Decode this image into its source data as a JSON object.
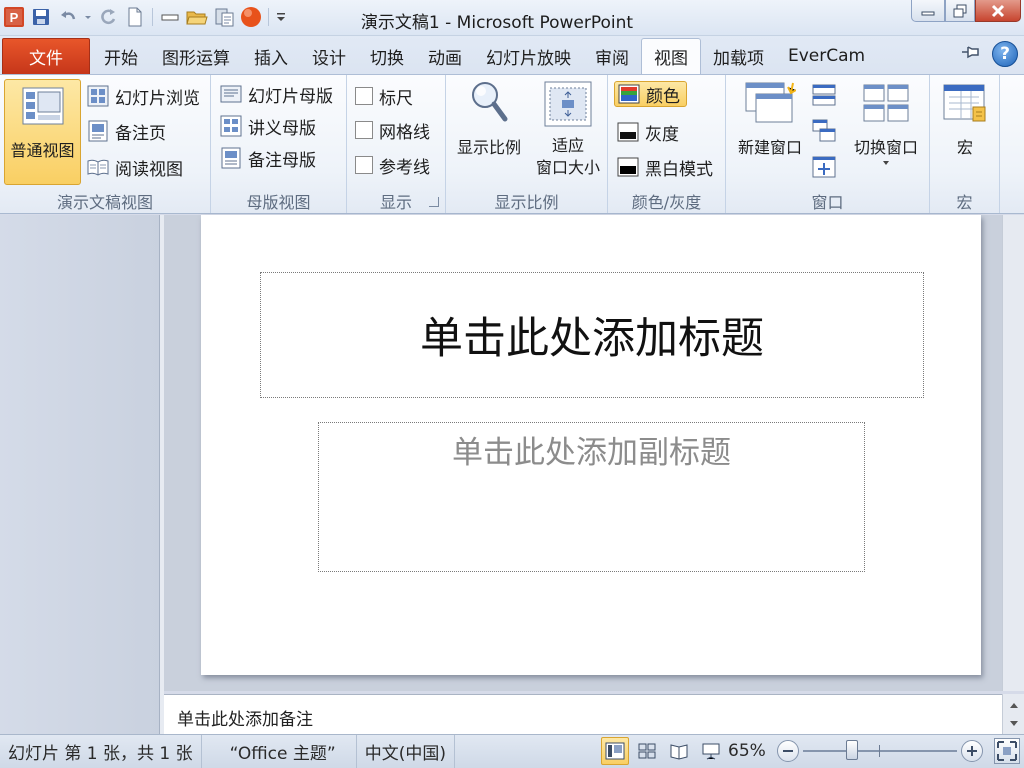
{
  "window": {
    "title": "演示文稿1 - Microsoft PowerPoint"
  },
  "quick_access": {
    "icons": [
      "powerpoint-logo-icon",
      "save-icon",
      "undo-icon",
      "redo-icon",
      "new-document-icon",
      "minus-icon",
      "open-folder-icon",
      "clipboard-icon",
      "record-icon",
      "customize-dropdown-icon"
    ]
  },
  "tabs": {
    "file": "文件",
    "items": [
      "开始",
      "图形运算",
      "插入",
      "设计",
      "切换",
      "动画",
      "幻灯片放映",
      "审阅",
      "视图",
      "加载项",
      "EverCam"
    ],
    "active_index": 8
  },
  "ribbon": {
    "groups": {
      "presentation_views": {
        "label": "演示文稿视图",
        "normal": "普通视图",
        "slide_sorter": "幻灯片浏览",
        "notes_page": "备注页",
        "reading_view": "阅读视图"
      },
      "master_views": {
        "label": "母版视图",
        "slide_master": "幻灯片母版",
        "handout_master": "讲义母版",
        "notes_master": "备注母版"
      },
      "show": {
        "label": "显示",
        "ruler": "标尺",
        "gridlines": "网格线",
        "guides": "参考线"
      },
      "zoom": {
        "label": "显示比例",
        "zoom": "显示比例",
        "fit_line1": "适应",
        "fit_line2": "窗口大小"
      },
      "color": {
        "label": "颜色/灰度",
        "color": "颜色",
        "grayscale": "灰度",
        "black_white": "黑白模式"
      },
      "window": {
        "label": "窗口",
        "new_window": "新建窗口",
        "switch_windows": "切换窗口"
      },
      "macros": {
        "label": "宏",
        "macros": "宏"
      }
    }
  },
  "slide": {
    "title_placeholder": "单击此处添加标题",
    "subtitle_placeholder": "单击此处添加副标题"
  },
  "notes": {
    "placeholder": "单击此处添加备注"
  },
  "status": {
    "slide_info": "幻灯片 第 1 张，共 1 张",
    "theme": "“Office 主题”",
    "language": "中文(中国)",
    "zoom": "65%"
  },
  "colors": {
    "file_tab": "#d8461f",
    "selected_button": "#f9cf63",
    "ribbon_bg": "#eef3f9"
  }
}
